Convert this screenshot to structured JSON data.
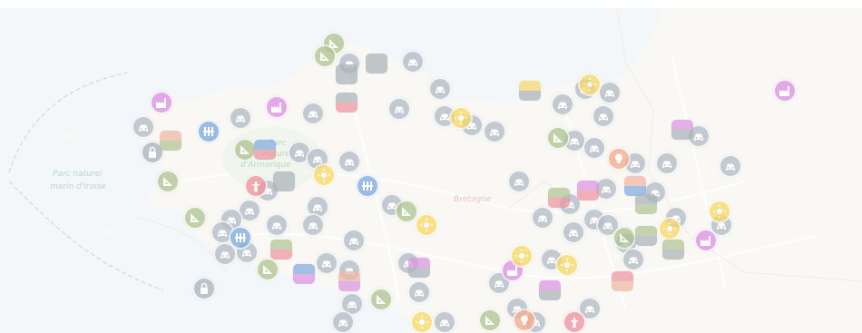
{
  "map": {
    "labels": {
      "marine_park_line1": "Parc naturel",
      "marine_park_line2": "marin d'Iroise",
      "region": "Bretagne",
      "park_line1": "Parc",
      "park_line2": "naturel",
      "park_line3": "d'Armorique"
    },
    "colors": {
      "water": "#eef3f6",
      "land": "#f7f5ef",
      "car": "#8a9aaa",
      "factory": "#c85ad2",
      "triangle": "#86a65a",
      "pillar": "#3d7fd0",
      "sun": "#f2c51a",
      "bulb": "#ee8050",
      "tower": "#e65c6e"
    },
    "marker_types": [
      "car-icon",
      "factory-icon",
      "set-square-icon",
      "pillar-icon",
      "sun-icon",
      "bulb-icon",
      "tower-icon",
      "lock-icon",
      "category-flag"
    ]
  }
}
